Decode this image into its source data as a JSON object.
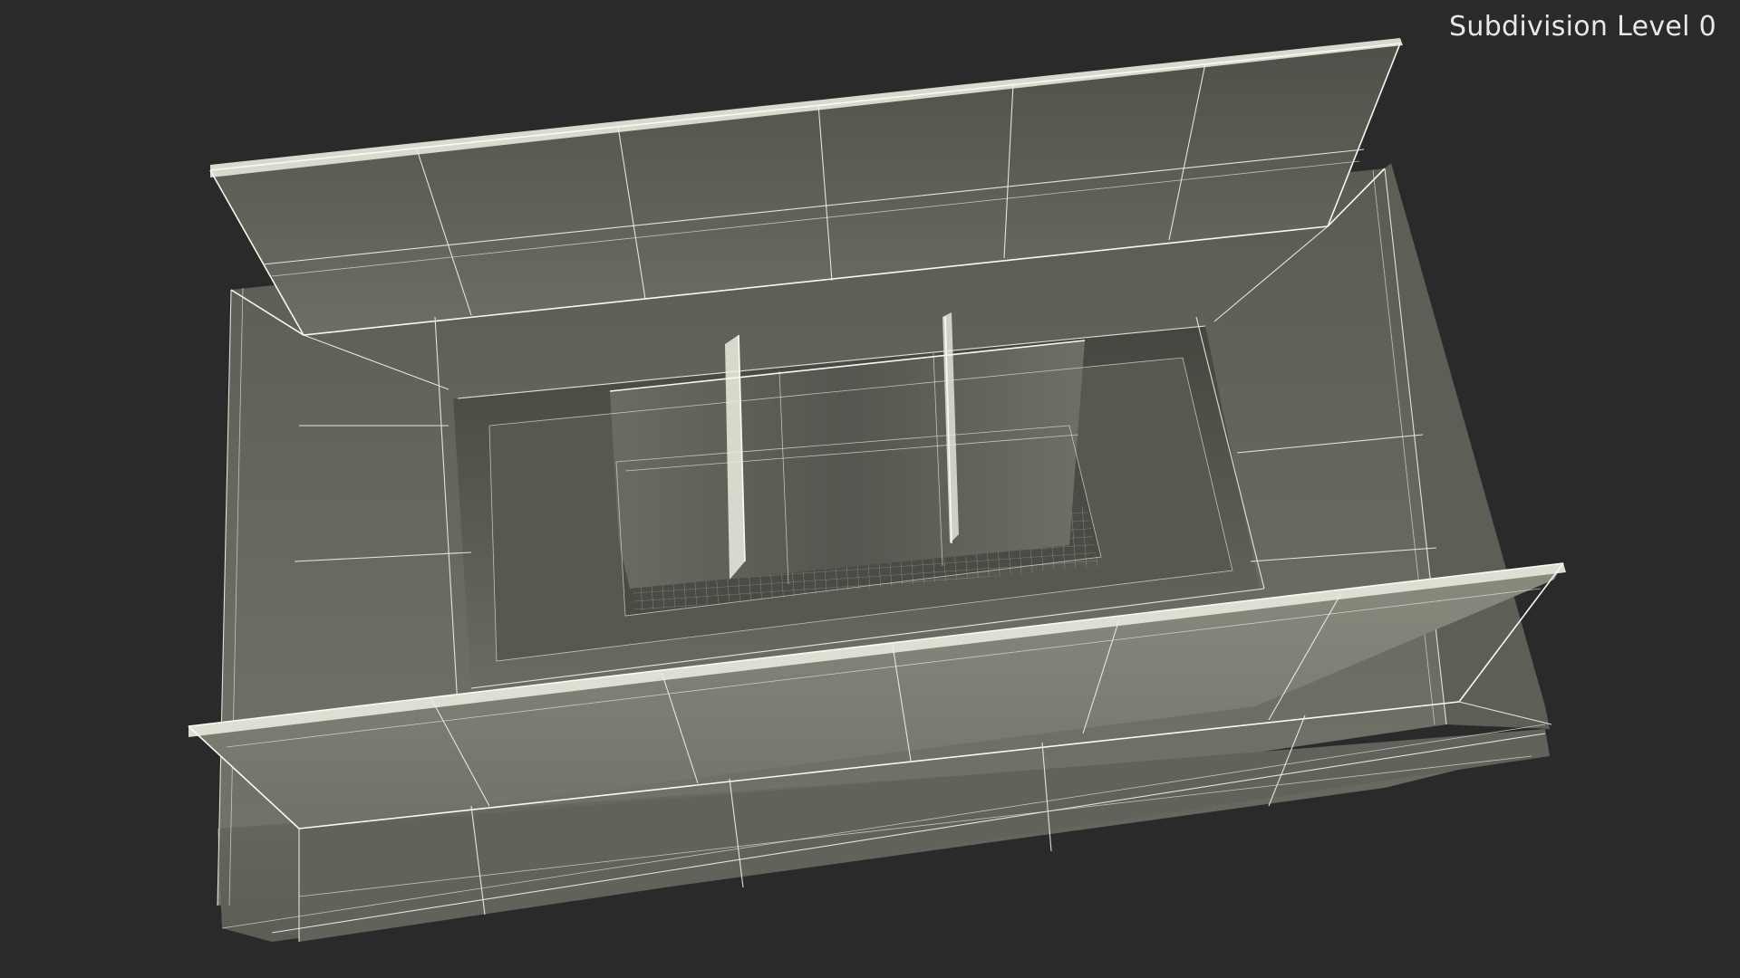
{
  "viewport": {
    "subdivision_label": "Subdivision Level 0"
  },
  "colors": {
    "background": "#2a2a2a",
    "mesh_light": "#8b8c80",
    "mesh_mid": "#6f7066",
    "mesh_dark": "#4f5049",
    "wire": "#f2f2ea"
  }
}
